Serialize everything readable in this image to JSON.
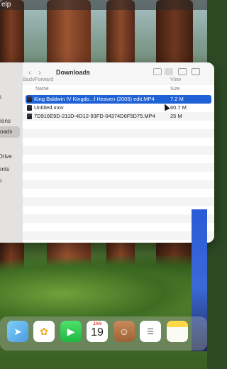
{
  "menubar": {
    "app_menu": "elp"
  },
  "finder": {
    "title": "Downloads",
    "nav_caption": "Back/Forward",
    "view_caption": "View",
    "sidebar": [
      {
        "label": "s"
      },
      {
        "label": "tions"
      },
      {
        "label": "oads"
      },
      {
        "label": "Drive"
      },
      {
        "label": "ents"
      },
      {
        "label": "p"
      }
    ],
    "columns": {
      "name": "Name",
      "size": "Size"
    },
    "files": [
      {
        "name": "King Baldwin IV  Kingdo...f Heaven (2005)  edit.MP4",
        "size": "7.2 M",
        "selected": true
      },
      {
        "name": "Untitled.mov",
        "size": "60.7 M",
        "selected": false
      },
      {
        "name": "7D916E9D-211D-4D12-93FD-04374D6F5D75.MP4",
        "size": "25 M",
        "selected": false
      }
    ]
  },
  "dock": {
    "calendar": {
      "month": "JAN",
      "day": "19"
    },
    "apps": [
      "maps-icon",
      "photos-icon",
      "facetime-icon",
      "calendar-icon",
      "contacts-icon",
      "reminders-icon",
      "notes-icon"
    ]
  }
}
